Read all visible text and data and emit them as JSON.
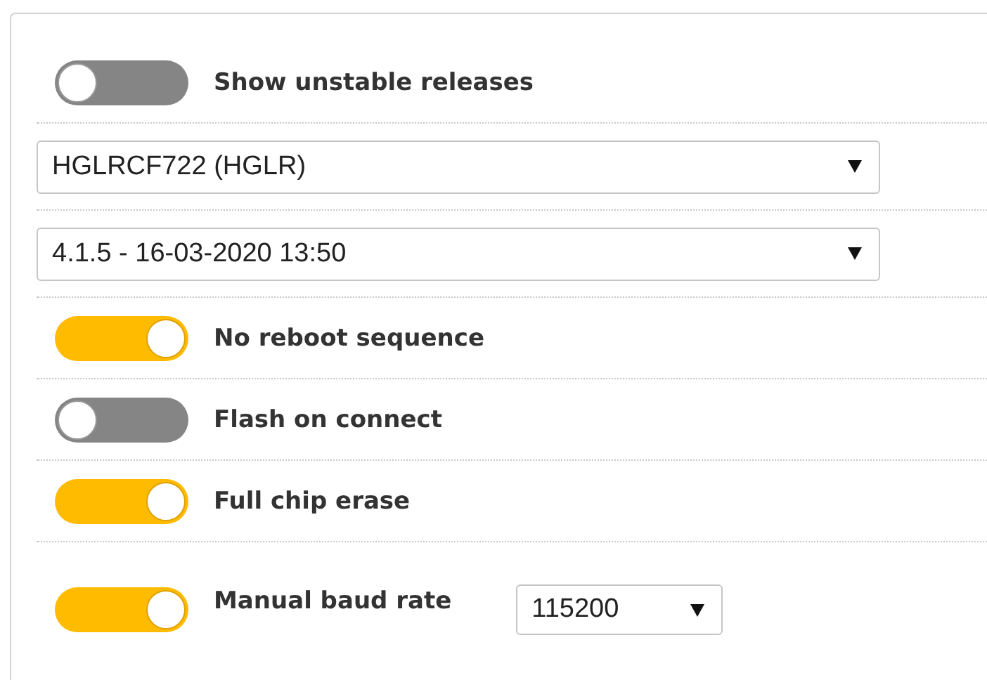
{
  "rows": [
    {
      "kind": "toggle",
      "on": false,
      "label": "Show unstable releases"
    },
    {
      "kind": "select",
      "value": "HGLRCF722 (HGLR)"
    },
    {
      "kind": "select",
      "value": "4.1.5 - 16-03-2020 13:50"
    },
    {
      "kind": "toggle",
      "on": true,
      "label": "No reboot sequence"
    },
    {
      "kind": "toggle",
      "on": false,
      "label": "Flash on connect"
    },
    {
      "kind": "toggle",
      "on": true,
      "label": "Full chip erase"
    },
    {
      "kind": "toggle",
      "on": true,
      "label": "Manual baud rate",
      "select": "115200"
    }
  ]
}
